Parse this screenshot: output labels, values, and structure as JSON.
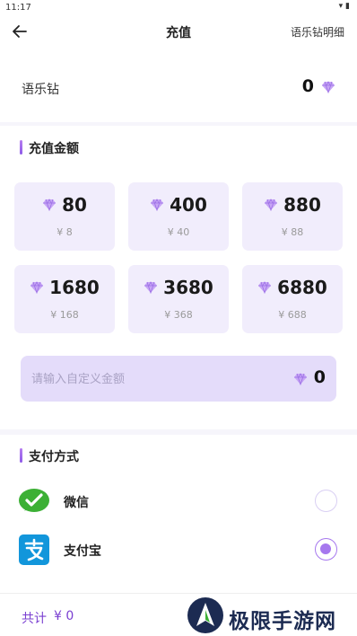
{
  "status_bar": {
    "time": "11:17",
    "icons": "▾ ▮"
  },
  "app_bar": {
    "title": "充值",
    "detail_link": "语乐钻明细"
  },
  "balance": {
    "label": "语乐钻",
    "amount": "0"
  },
  "recharge": {
    "title": "充值金额",
    "options": [
      {
        "amount": "80",
        "price": "¥ 8"
      },
      {
        "amount": "400",
        "price": "¥ 40"
      },
      {
        "amount": "880",
        "price": "¥ 88"
      },
      {
        "amount": "1680",
        "price": "¥ 168"
      },
      {
        "amount": "3680",
        "price": "¥ 368"
      },
      {
        "amount": "6880",
        "price": "¥ 688"
      }
    ],
    "custom_placeholder": "请输入自定义金额",
    "custom_value": "0"
  },
  "payment": {
    "title": "支付方式",
    "methods": [
      {
        "label": "微信",
        "icon": "wechat-icon",
        "selected": false
      },
      {
        "label": "支付宝",
        "icon": "alipay-icon",
        "selected": true
      }
    ]
  },
  "bottom": {
    "total_label": "共计",
    "total_value": "¥ 0"
  },
  "watermark": {
    "text": "极限手游网"
  },
  "colors": {
    "accent": "#a678ee",
    "card_bg": "#f1edfc",
    "input_bg": "#e4dcfa",
    "wechat": "#3cb035",
    "alipay": "#1296db"
  }
}
